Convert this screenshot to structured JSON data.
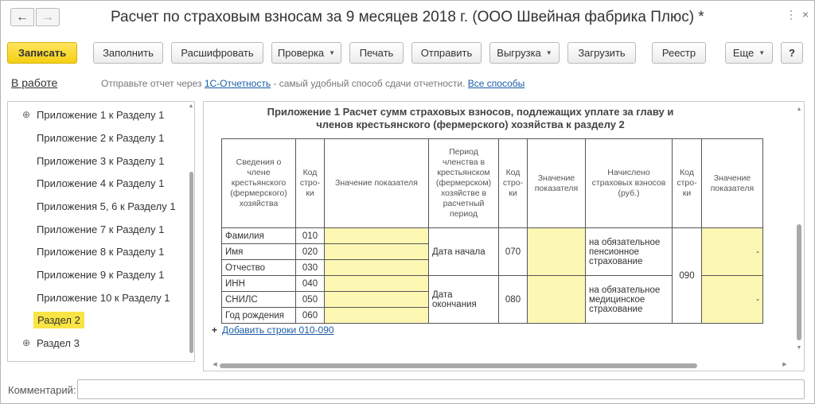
{
  "window": {
    "title": "Расчет по страховым взносам за 9 месяцев 2018 г. (ООО Швейная фабрика Плюс) *",
    "back_icon": "←",
    "forward_icon": "→",
    "more_icon": "⋮",
    "close_icon": "×"
  },
  "toolbar": {
    "save": "Записать",
    "fill": "Заполнить",
    "decode": "Расшифровать",
    "check": "Проверка",
    "print": "Печать",
    "send": "Отправить",
    "export": "Выгрузка",
    "load": "Загрузить",
    "registry": "Реестр",
    "more": "Еще",
    "help": "?"
  },
  "infobar": {
    "status": "В работе",
    "text_before": "Отправьте отчет через ",
    "link1": "1С-Отчетность",
    "text_after": " - самый удобный способ сдачи отчетности. ",
    "link2": "Все способы"
  },
  "tree": {
    "items": [
      {
        "label": "Приложение 1 к Разделу 1"
      },
      {
        "label": "Приложение 2 к Разделу 1"
      },
      {
        "label": "Приложение 3 к Разделу 1"
      },
      {
        "label": "Приложение 4 к Разделу 1"
      },
      {
        "label": "Приложения 5, 6 к Разделу 1"
      },
      {
        "label": "Приложение 7 к Разделу 1"
      },
      {
        "label": "Приложение 8 к Разделу 1"
      },
      {
        "label": "Приложение 9 к Разделу 1"
      },
      {
        "label": "Приложение 10 к Разделу 1"
      },
      {
        "label": "Раздел 2"
      },
      {
        "label": "Раздел 3"
      }
    ],
    "expander": "⊕"
  },
  "form": {
    "heading_line1": "Приложение 1 Расчет сумм страховых взносов, подлежащих уплате за главу и",
    "heading_line2": "членов крестьянского (фермерского) хозяйства к разделу 2",
    "headers": {
      "member_info": "Сведения о члене крестьянского (фермерского) хозяйства",
      "line_code1": "Код стро-ки",
      "value1": "Значение показателя",
      "period": "Период членства в крестьянском (фермерском) хозяйстве в расчетный период",
      "line_code2": "Код стро-ки",
      "value2": "Значение показателя",
      "accrued": "Начислено страховых взносов (руб.)",
      "line_code3": "Код стро-ки",
      "value3": "Значение показателя"
    },
    "rows": [
      {
        "label": "Фамилия",
        "code": "010"
      },
      {
        "label": "Имя",
        "code": "020"
      },
      {
        "label": "Отчество",
        "code": "030"
      },
      {
        "label": "ИНН",
        "code": "040"
      },
      {
        "label": "СНИЛС",
        "code": "050"
      },
      {
        "label": "Год рождения",
        "code": "060"
      }
    ],
    "period_start": "Дата начала",
    "period_start_code": "070",
    "period_end": "Дата окончания",
    "period_end_code": "080",
    "pension": "на обязательное пенсионное страхование",
    "medical": "на обязательное медицинское страхование",
    "accrued_code": "090",
    "pension_value": "-",
    "medical_value": "-",
    "add_plus": "+",
    "add_rows": "Добавить строки 010-090"
  },
  "comment": {
    "label": "Комментарий:",
    "value": ""
  }
}
